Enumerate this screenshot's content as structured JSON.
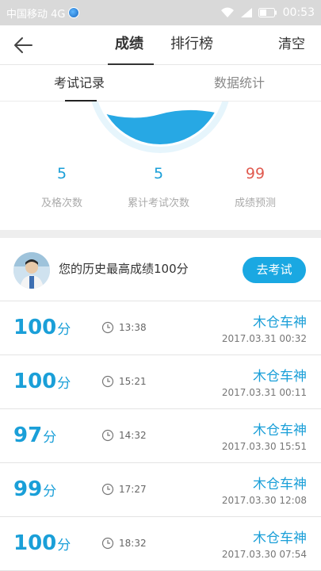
{
  "status_bar": {
    "carrier": "中国移动 4G",
    "time": "00:53"
  },
  "nav": {
    "back_icon": "back-arrow-icon",
    "tabs": [
      {
        "label": "成绩",
        "active": true
      },
      {
        "label": "排行榜",
        "active": false
      }
    ],
    "clear_label": "清空"
  },
  "subtabs": [
    {
      "label": "考试记录",
      "active": true
    },
    {
      "label": "数据统计",
      "active": false
    }
  ],
  "stats": [
    {
      "value": "5",
      "label": "及格次数",
      "color": "#1a9fd8"
    },
    {
      "value": "5",
      "label": "累计考试次数",
      "color": "#1a9fd8"
    },
    {
      "value": "99",
      "label": "成绩预测",
      "color": "#e05a4f"
    }
  ],
  "best": {
    "text": "您的历史最高成绩100分",
    "button_label": "去考试"
  },
  "records": [
    {
      "score": "100",
      "unit": "分",
      "duration": "13:38",
      "name": "木仓车神",
      "date": "2017.03.31  00:32"
    },
    {
      "score": "100",
      "unit": "分",
      "duration": "15:21",
      "name": "木仓车神",
      "date": "2017.03.31  00:11"
    },
    {
      "score": "97",
      "unit": "分",
      "duration": "14:32",
      "name": "木仓车神",
      "date": "2017.03.30  15:51"
    },
    {
      "score": "99",
      "unit": "分",
      "duration": "17:27",
      "name": "木仓车神",
      "date": "2017.03.30  12:08"
    },
    {
      "score": "100",
      "unit": "分",
      "duration": "18:32",
      "name": "木仓车神",
      "date": "2017.03.30  07:54"
    }
  ],
  "colors": {
    "accent": "#1aa8e2",
    "score": "#1a9fd8",
    "prediction": "#e05a4f"
  }
}
